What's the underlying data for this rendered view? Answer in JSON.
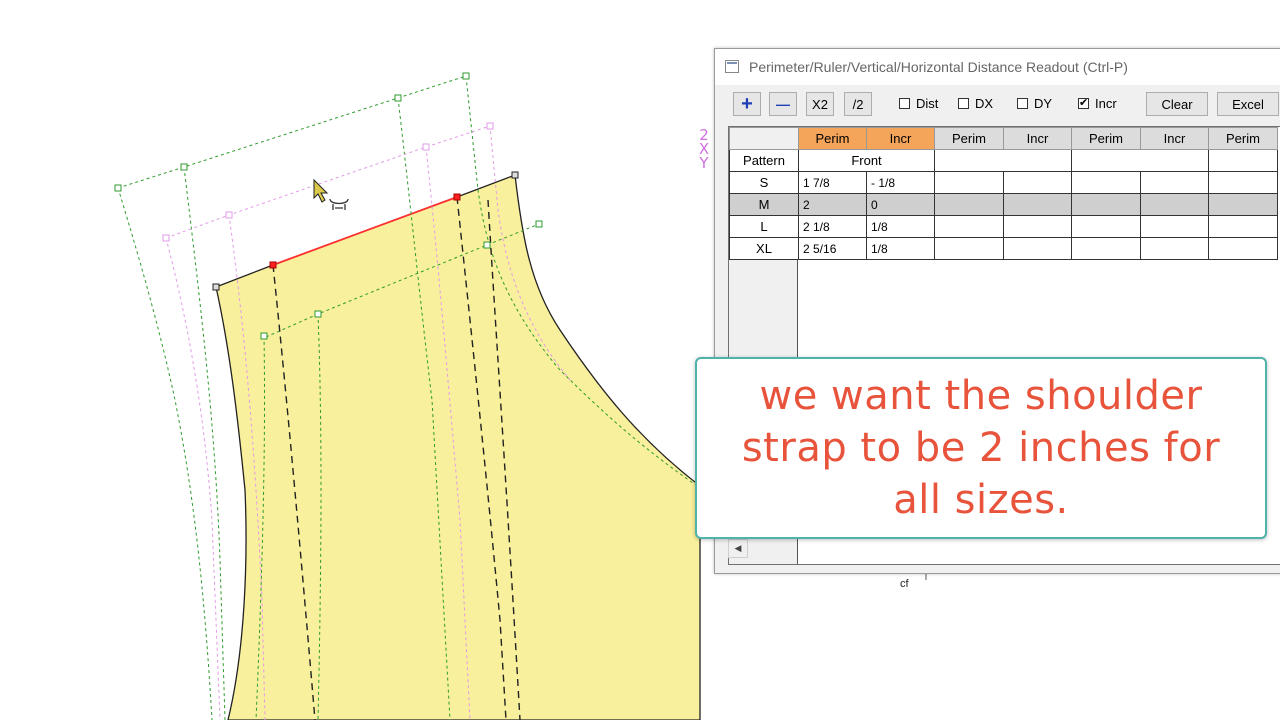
{
  "dialog": {
    "title": "Perimeter/Ruler/Vertical/Horizontal Distance Readout (Ctrl-P)",
    "toolbar": {
      "plus": "+",
      "minus": "—",
      "x2": "X2",
      "half": "/2",
      "dist": "Dist",
      "dx": "DX",
      "dy": "DY",
      "incr": "Incr",
      "clear": "Clear",
      "excel": "Excel"
    },
    "checks": {
      "dist": false,
      "dx": false,
      "dy": false,
      "incr": true
    },
    "headers": [
      "Perim",
      "Incr",
      "Perim",
      "Incr",
      "Perim",
      "Incr",
      "Perim"
    ],
    "pattern_label": "Pattern",
    "piece_name": "Front",
    "rows": [
      {
        "size": "S",
        "perim": "1 7/8",
        "incr": "- 1/8"
      },
      {
        "size": "M",
        "perim": "2",
        "incr": "0"
      },
      {
        "size": "L",
        "perim": "2 1/8",
        "incr": "1/8"
      },
      {
        "size": "XL",
        "perim": "2 5/16",
        "incr": "1/8"
      }
    ],
    "selected_size": "M",
    "scroll_left": "◀"
  },
  "canvas": {
    "axis_labels": [
      "2",
      "X",
      "Y"
    ],
    "cf_label": "cf",
    "colors": {
      "piece_fill": "#f8f09c",
      "grade_green": "#2e9a2e",
      "grade_pink": "#e29be8",
      "selected_line": "#ff3030",
      "header_orange": "#f5a55a"
    }
  },
  "caption": {
    "text": "we want the shoulder strap to be 2 inches for all sizes."
  }
}
